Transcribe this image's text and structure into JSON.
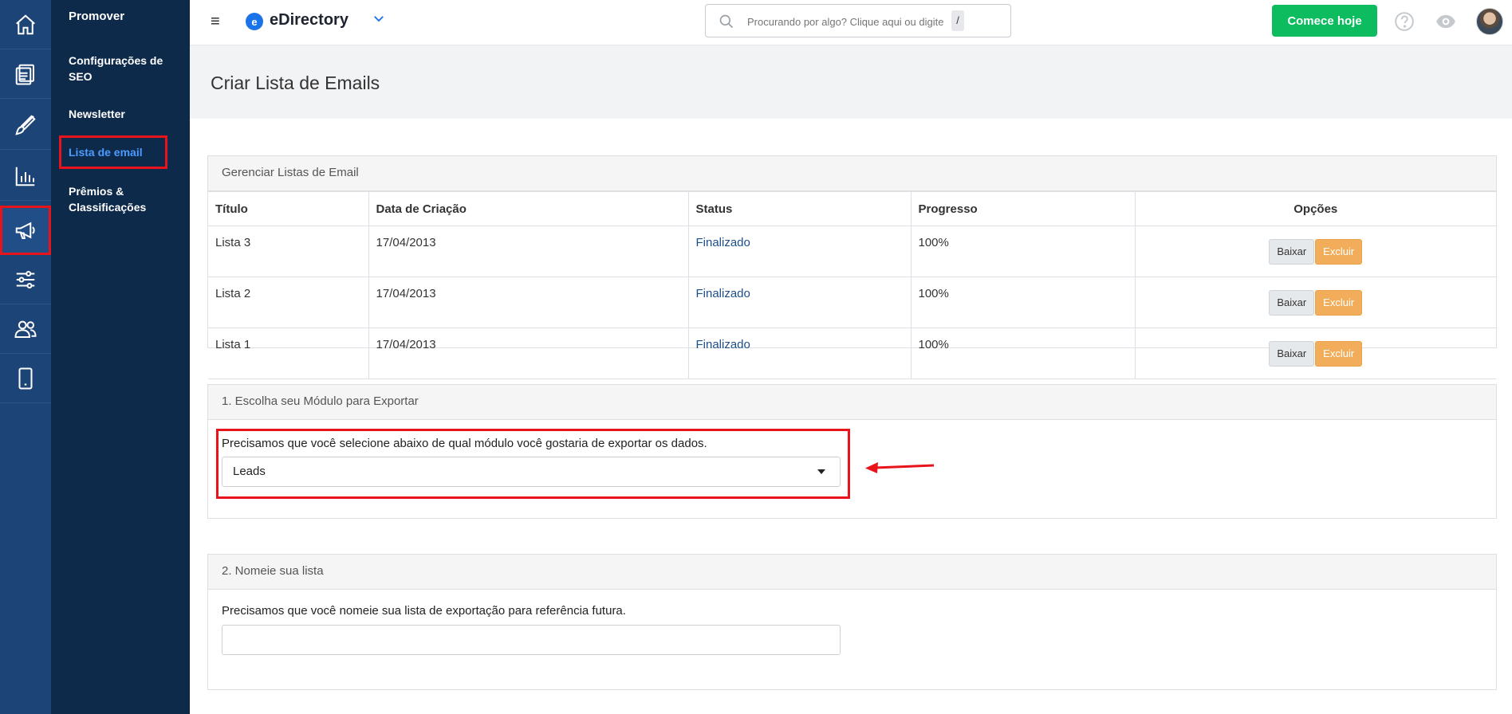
{
  "colors": {
    "rail_bg": "#1d4477",
    "submenu_bg": "#0e2a4b",
    "active_link": "#4d9bff",
    "cta_green": "#0cbc5f",
    "excluir_orange": "#f1ad59",
    "status_link": "#1c4f8a",
    "highlight_red": "#e8131b"
  },
  "rail": {
    "icons": [
      "home-icon",
      "documents-icon",
      "brush-icon",
      "chart-bar-icon",
      "megaphone-icon",
      "sliders-icon",
      "users-icon",
      "mobile-icon"
    ],
    "active": "megaphone-icon"
  },
  "submenu": {
    "title": "Promover",
    "items": [
      {
        "label": "Configurações de SEO"
      },
      {
        "label": "Newsletter"
      },
      {
        "label": "Lista de email",
        "active": true
      },
      {
        "label": "Prêmios & Classificações"
      }
    ]
  },
  "header": {
    "menu_icon": "≡",
    "logo_letter": "e",
    "brand": "eDirectory",
    "search_placeholder": "Procurando por algo? Clique aqui ou digite",
    "search_shortcut": "/",
    "cta_label": "Comece hoje"
  },
  "page": {
    "title": "Criar Lista de Emails"
  },
  "lists_panel": {
    "heading": "Gerenciar Listas de Email",
    "columns": [
      "Título",
      "Data de Criação",
      "Status",
      "Progresso",
      "Opções"
    ],
    "rows": [
      {
        "titulo": "Lista 3",
        "data": "17/04/2013",
        "status": "Finalizado",
        "progresso": "100%"
      },
      {
        "titulo": "Lista 2",
        "data": "17/04/2013",
        "status": "Finalizado",
        "progresso": "100%"
      },
      {
        "titulo": "Lista 1",
        "data": "17/04/2013",
        "status": "Finalizado",
        "progresso": "100%"
      }
    ],
    "download_label": "Baixar",
    "delete_label": "Excluir"
  },
  "module_panel": {
    "heading": "1. Escolha seu Módulo para Exportar",
    "help": "Precisamos que você selecione abaixo de qual módulo você gostaria de exportar os dados.",
    "selected": "Leads"
  },
  "name_panel": {
    "heading": "2. Nomeie sua lista",
    "help": "Precisamos que você nomeie sua lista de exportação para referência futura.",
    "value": ""
  }
}
